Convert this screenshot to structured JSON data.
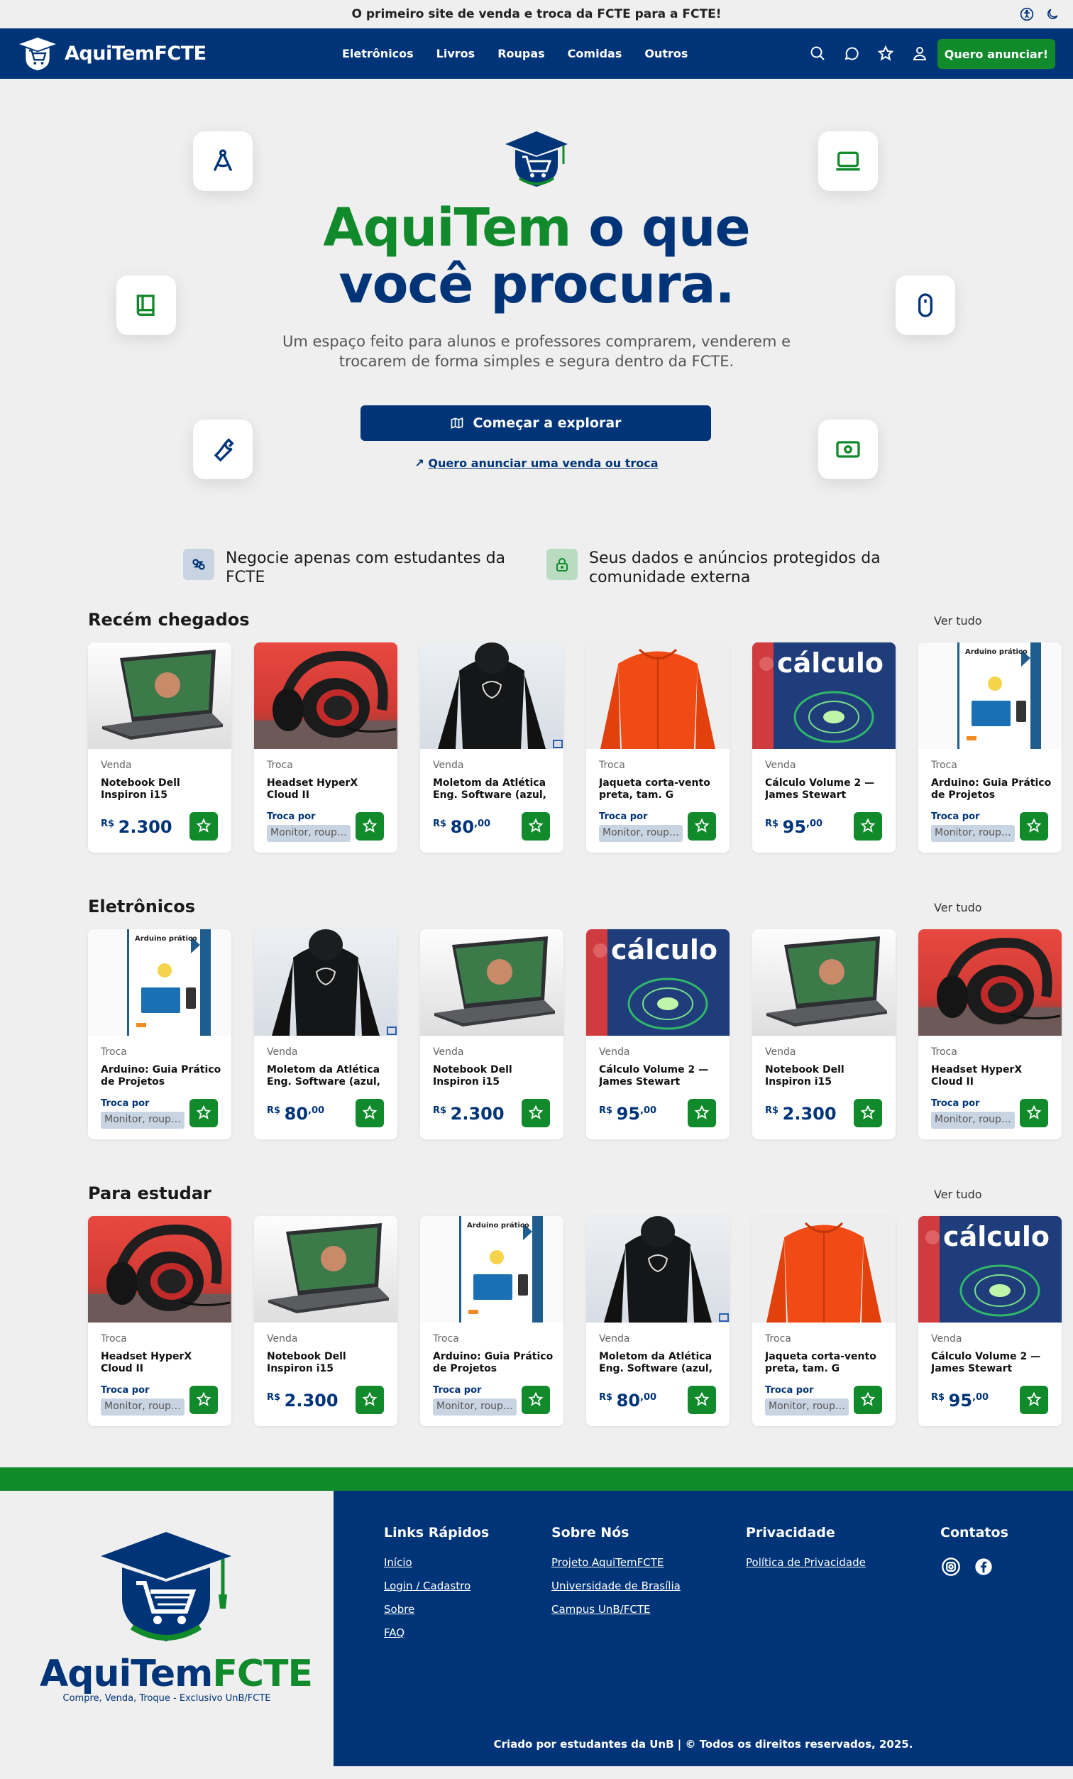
{
  "topbar": {
    "message": "O primeiro site de venda e troca da FCTE para a FCTE!",
    "icons": [
      "accessibility-icon",
      "moon-icon"
    ]
  },
  "navbar": {
    "brand": "AquiTemFCTE",
    "links": [
      "Eletrônicos",
      "Livros",
      "Roupas",
      "Comidas",
      "Outros"
    ],
    "icons": [
      "search-icon",
      "chat-icon",
      "star-icon",
      "user-icon"
    ],
    "cta": "Quero anunciar!"
  },
  "hero": {
    "title_green": "AquiTem",
    "title_rest_line1": " o que",
    "title_line2": "você procura.",
    "subtitle": "Um espaço feito para alunos e professores comprarem, venderem e trocarem de forma simples e segura dentro da FCTE.",
    "explore_button": "Começar a explorar",
    "announce_link": "Quero anunciar uma venda ou troca",
    "float_icons": [
      "compass-icon",
      "laptop-icon",
      "book-icon",
      "mouse-icon",
      "wrench-icon",
      "money-icon"
    ]
  },
  "features": [
    {
      "icon": "handshake-icon",
      "text": "Negocie apenas com estudantes da FCTE"
    },
    {
      "icon": "lock-icon",
      "text": "Seus dados e anúncios protegidos da comunidade externa"
    }
  ],
  "colors": {
    "primary": "#003478",
    "accent": "#118a2c",
    "background": "#efefef"
  },
  "sections": [
    {
      "title": "Recém chegados",
      "more": "Ver tudo",
      "cards": [
        {
          "image": "laptop",
          "type": "Venda",
          "title": "Notebook Dell Inspiron i15",
          "currency": "R$",
          "price": "2.300",
          "cents": ""
        },
        {
          "image": "headset",
          "type": "Troca",
          "title": "Headset HyperX Cloud II",
          "trade_label": "Troca por",
          "trade_value": "Monitor, roupa..."
        },
        {
          "image": "hoodie",
          "type": "Venda",
          "title": "Moletom da Atlética Eng. Software (azul, ta...",
          "currency": "R$",
          "price": "80",
          "cents": ",00"
        },
        {
          "image": "jacket",
          "type": "Troca",
          "title": "Jaqueta corta-vento preta, tam. G",
          "trade_label": "Troca por",
          "trade_value": "Monitor, roupa..."
        },
        {
          "image": "calculo",
          "type": "Venda",
          "title": "Cálculo Volume 2 — James Stewart",
          "currency": "R$",
          "price": "95",
          "cents": ",00"
        },
        {
          "image": "arduino",
          "type": "Troca",
          "title": "Arduino: Guia Prático de Projetos",
          "trade_label": "Troca por",
          "trade_value": "Monitor, roupa..."
        }
      ]
    },
    {
      "title": "Eletrônicos",
      "more": "Ver tudo",
      "cards": [
        {
          "image": "arduino",
          "type": "Troca",
          "title": "Arduino: Guia Prático de Projetos",
          "trade_label": "Troca por",
          "trade_value": "Monitor, roupa..."
        },
        {
          "image": "hoodie",
          "type": "Venda",
          "title": "Moletom da Atlética Eng. Software (azul, ta...",
          "currency": "R$",
          "price": "80",
          "cents": ",00"
        },
        {
          "image": "laptop",
          "type": "Venda",
          "title": "Notebook Dell Inspiron i15",
          "currency": "R$",
          "price": "2.300",
          "cents": ""
        },
        {
          "image": "calculo",
          "type": "Venda",
          "title": "Cálculo Volume 2 — James Stewart",
          "currency": "R$",
          "price": "95",
          "cents": ",00"
        },
        {
          "image": "laptop",
          "type": "Venda",
          "title": "Notebook Dell Inspiron i15",
          "currency": "R$",
          "price": "2.300",
          "cents": ""
        },
        {
          "image": "headset",
          "type": "Troca",
          "title": "Headset HyperX Cloud II",
          "trade_label": "Troca por",
          "trade_value": "Monitor, roupa..."
        }
      ]
    },
    {
      "title": "Para estudar",
      "more": "Ver tudo",
      "cards": [
        {
          "image": "headset",
          "type": "Troca",
          "title": "Headset HyperX Cloud II",
          "trade_label": "Troca por",
          "trade_value": "Monitor, roupa..."
        },
        {
          "image": "laptop",
          "type": "Venda",
          "title": "Notebook Dell Inspiron i15",
          "currency": "R$",
          "price": "2.300",
          "cents": ""
        },
        {
          "image": "arduino",
          "type": "Troca",
          "title": "Arduino: Guia Prático de Projetos",
          "trade_label": "Troca por",
          "trade_value": "Monitor, roupa..."
        },
        {
          "image": "hoodie",
          "type": "Venda",
          "title": "Moletom da Atlética Eng. Software (azul, ta...",
          "currency": "R$",
          "price": "80",
          "cents": ",00"
        },
        {
          "image": "jacket",
          "type": "Troca",
          "title": "Jaqueta corta-vento preta, tam. G",
          "trade_label": "Troca por",
          "trade_value": "Monitor, roupa..."
        },
        {
          "image": "calculo",
          "type": "Venda",
          "title": "Cálculo Volume 2 — James Stewart",
          "currency": "R$",
          "price": "95",
          "cents": ",00"
        }
      ]
    }
  ],
  "image_text": {
    "calculo": "cálculo",
    "arduino": "Arduino prático"
  },
  "footer": {
    "logo_blue": "AquiTem",
    "logo_green": "FCTE",
    "tagline": "Compre, Venda, Troque - Exclusivo UnB/FCTE",
    "columns": [
      {
        "title": "Links Rápidos",
        "links": [
          "Início",
          "Login / Cadastro",
          "Sobre",
          "FAQ"
        ]
      },
      {
        "title": "Sobre Nós",
        "links": [
          "Projeto AquiTemFCTE",
          "Universidade de Brasília",
          "Campus UnB/FCTE"
        ]
      },
      {
        "title": "Privacidade",
        "links": [
          "Política de Privacidade"
        ]
      },
      {
        "title": "Contatos",
        "social": [
          "instagram-icon",
          "facebook-icon"
        ]
      }
    ],
    "copyright": "Criado por estudantes da UnB | © Todos os direitos reservados, 2025."
  }
}
